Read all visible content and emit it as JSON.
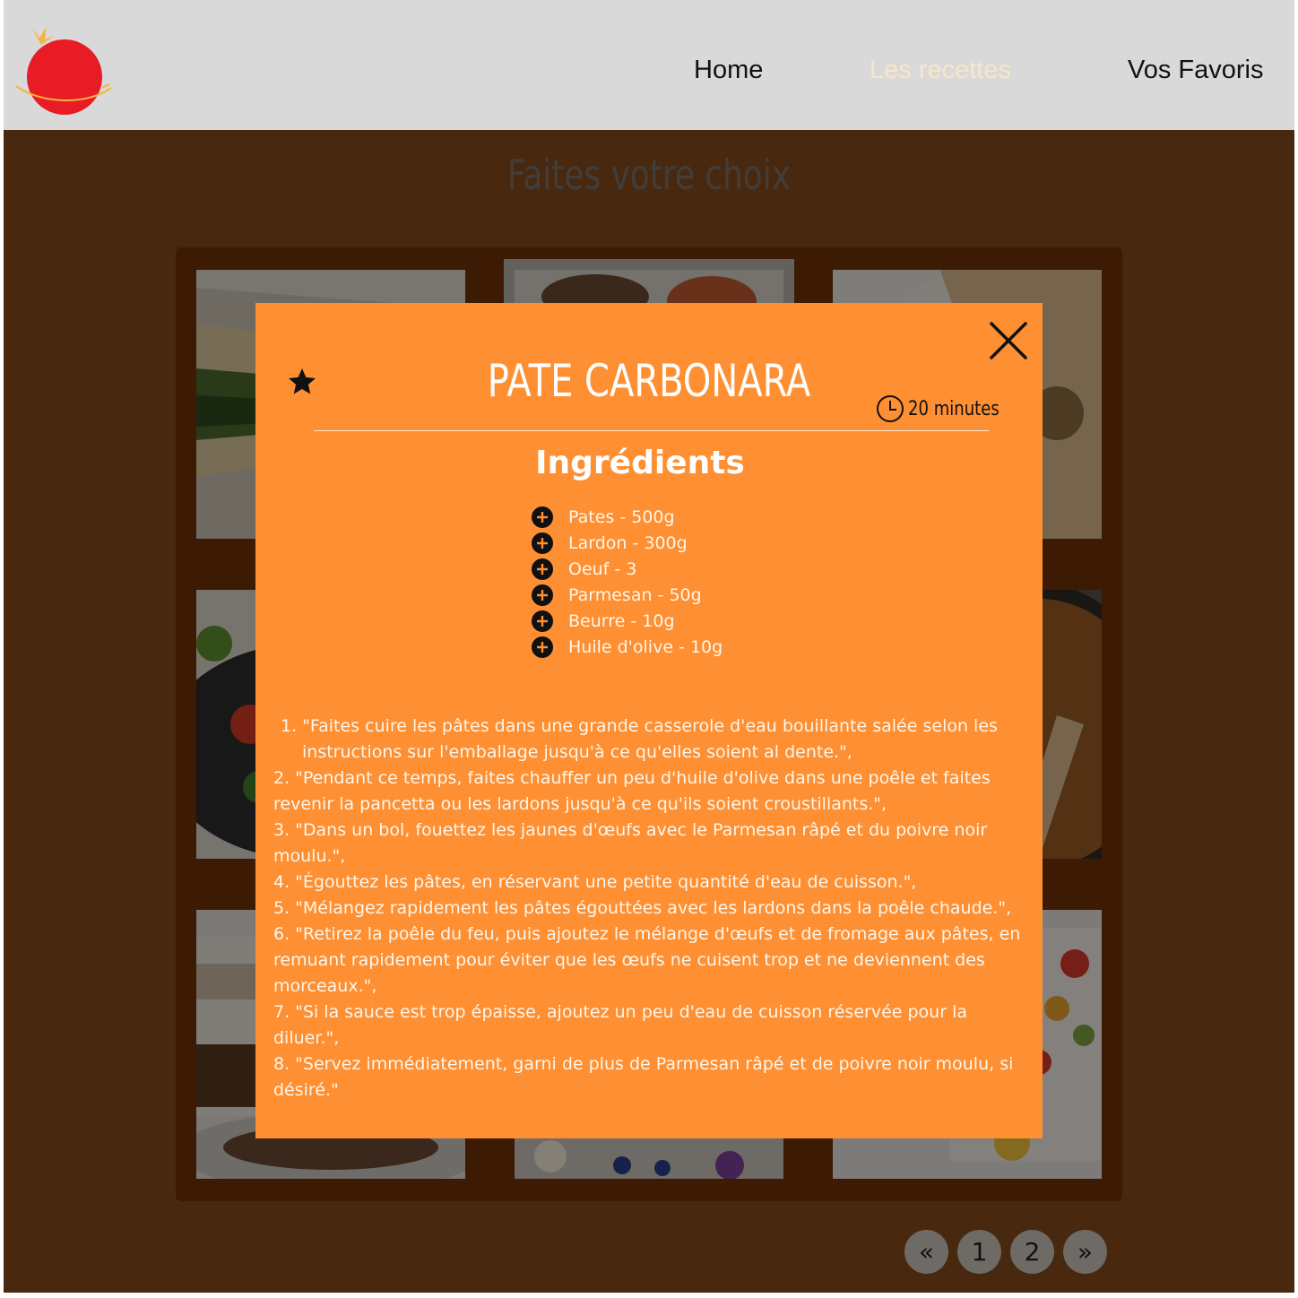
{
  "nav": {
    "links": [
      {
        "label": "Home",
        "active": false
      },
      {
        "label": "Les recettes",
        "active": true
      },
      {
        "label": "Vos Favoris",
        "active": false
      }
    ]
  },
  "page": {
    "title": "Faites votre choix"
  },
  "pagination": {
    "prev": "«",
    "pages": [
      "1",
      "2"
    ],
    "next": "»"
  },
  "modal": {
    "title": "PATE CARBONARA",
    "time": "20 minutes",
    "ingredients_heading": "Ingrédients",
    "ingredients": [
      "Pates - 500g",
      "Lardon - 300g",
      "Oeuf - 3",
      "Parmesan - 50g",
      "Beurre - 10g",
      "Huile d'olive - 10g"
    ],
    "steps": [
      "1. \"Faites cuire les pâtes dans une grande casserole d'eau bouillante salée selon les instructions sur l'emballage jusqu'à ce qu'elles soient al dente.\",",
      "2. \"Pendant ce temps, faites chauffer un peu d'huile d'olive dans une poêle et faites revenir la pancetta ou les lardons jusqu'à ce qu'ils soient croustillants.\",",
      "3. \"Dans un bol, fouettez les jaunes d'œufs avec le Parmesan râpé et du poivre noir moulu.\",",
      "4. \"Égouttez les pâtes, en réservant une petite quantité d'eau de cuisson.\",",
      "5. \"Mélangez rapidement les pâtes égouttées avec les lardons dans la poêle chaude.\",",
      "6. \"Retirez la poêle du feu, puis ajoutez le mélange d'œufs et de fromage aux pâtes, en remuant rapidement pour éviter que les œufs ne cuisent trop et ne deviennent des morceaux.\",",
      "7. \"Si la sauce est trop épaisse, ajoutez un peu d'eau de cuisson réservée pour la diluer.\",",
      "8. \"Servez immédiatement, garni de plus de Parmesan râpé et de poivre noir moulu, si désiré.\""
    ]
  },
  "colors": {
    "header_bg": "#d9d9d9",
    "page_bg": "#84491b",
    "modal_bg": "#fe8f32",
    "logo_red": "#e81c24",
    "active_nav": "#f7e6c8"
  }
}
